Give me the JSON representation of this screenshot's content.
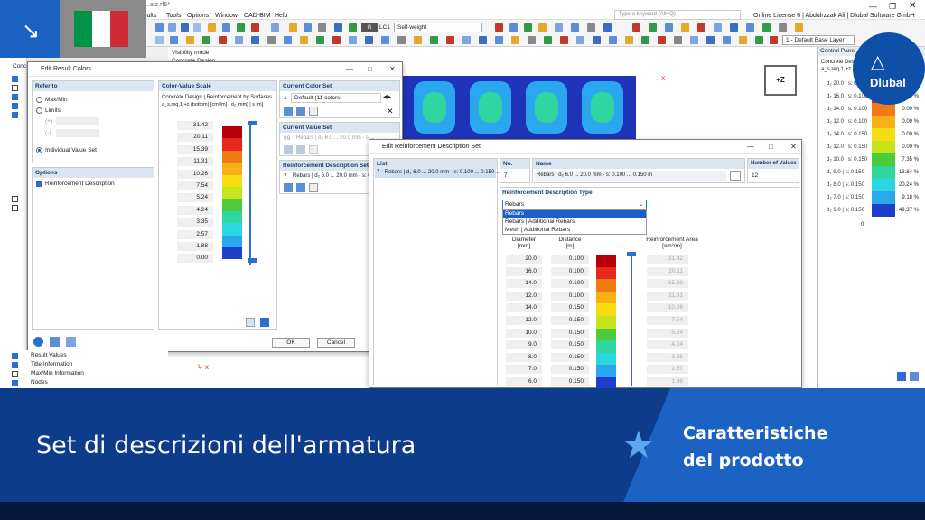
{
  "app": {
    "file_title": "...atz.rf6*",
    "menus": [
      "Results",
      "Tools",
      "Options",
      "Window",
      "CAD-BIM",
      "Help"
    ],
    "search_placeholder": "Type a keyword (Alt+Q)",
    "license_text": "Online License 6 | Abdulrzzak Ali | Dlubal Software GmbH",
    "load_case_badge": "G",
    "load_case": "LC1",
    "load_case_name": "Self-weight",
    "base_layer": "1 - Default Base Layer",
    "visibility_mode": "Visibility mode",
    "concrete_design": "Concrete Design",
    "view_label": "+Z",
    "nav_label": "Conc"
  },
  "navigator_bottom": {
    "items": [
      "Result Values",
      "Title Information",
      "Max/Min Information",
      "Nodes"
    ]
  },
  "control_panel": {
    "title": "Control Panel",
    "subtitle1": "Concrete Design | Reinf...",
    "subtitle2": "a_s,req,1,+z (bottom)",
    "rows": [
      {
        "label": "d₂ 20.0 | s: 0.100",
        "pct": "0.00 %",
        "color": "#b5000c"
      },
      {
        "label": "d₂ 16.0 | s: 0.100",
        "pct": "0.00 %",
        "color": "#e8281c"
      },
      {
        "label": "d₂ 14.0 | s: 0.100",
        "pct": "0.00 %",
        "color": "#f07a14"
      },
      {
        "label": "d₂ 12.0 | s: 0.100",
        "pct": "0.00 %",
        "color": "#f7b016"
      },
      {
        "label": "d₂ 14.0 | s: 0.150",
        "pct": "0.00 %",
        "color": "#f5dd12"
      },
      {
        "label": "d₂ 12.0 | s: 0.150",
        "pct": "0.00 %",
        "color": "#c6e41c"
      },
      {
        "label": "d₂ 10.0 | s: 0.150",
        "pct": "7.35 %",
        "color": "#4ccc3c"
      },
      {
        "label": "d₂ 9.0 | s: 0.150",
        "pct": "13.84 %",
        "color": "#2fd6a0"
      },
      {
        "label": "d₂ 8.0 | s: 0.150",
        "pct": "20.24 %",
        "color": "#2ad6e0"
      },
      {
        "label": "d₂ 7.0 | s: 0.150",
        "pct": "9.18 %",
        "color": "#2aa8ee"
      },
      {
        "label": "d₂ 6.0 | s: 0.150",
        "pct": "49.37 %",
        "color": "#1c3ec8"
      }
    ],
    "last_value": "0"
  },
  "dialog1": {
    "title": "Edit Result Colors",
    "refer_to": "Refer to",
    "opt_maxmin": "Max/Min",
    "opt_limits": "Limits",
    "plus": "(+)",
    "minus": "(-)",
    "opt_individual": "Individual Value Set",
    "options": "Options",
    "reinf_desc": "Reinforcement Description",
    "color_value_scale": "Color-Value Scale",
    "scale_line1": "Concrete Design | Reinforcement by Surfaces",
    "scale_line2": "a_s,req,1,+z (bottom) [cm²/m] | d₂ [mm] | s [m]",
    "scale_values": [
      "31.42",
      "20.11",
      "15.39",
      "11.31",
      "10.26",
      "7.54",
      "5.24",
      "4.24",
      "3.35",
      "2.57",
      "1.88",
      "0.00"
    ],
    "scale_colors": [
      "#b5000c",
      "#e8281c",
      "#f07a14",
      "#f7b016",
      "#f5dd12",
      "#c6e41c",
      "#4ccc3c",
      "#2fd6a0",
      "#2ad6e0",
      "#2aa8ee",
      "#1c3ec8"
    ],
    "current_color_set": "Current Color Set",
    "color_set_no": "1",
    "color_set_name": "Default (11 colors)",
    "current_value_set": "Current Value Set",
    "value_set_no": "99",
    "value_set_name": "Rebars | d₂ 6.0 ... 20.0 mm - s ...",
    "reinf_desc_set": "Reinforcement Description Set",
    "reinf_set_no": "7",
    "reinf_set_name": "Rebars | d₂ 6.0 ... 20.0 mm - s: 0.100 ...",
    "ok": "OK",
    "cancel": "Cancel"
  },
  "dialog2": {
    "title": "Edit Reinforcement Description Set",
    "list_head": "List",
    "list_item": "7 - Rebars | d₂ 6.0 ... 20.0 mm - s: 0.100 ... 0.150 ...",
    "no_head": "No.",
    "no_value": "7",
    "name_head": "Name",
    "name_value": "Rebars | d₂ 6.0 ... 20.0 mm - s: 0.100 ... 0.150 m",
    "num_values_head": "Number of Values",
    "num_values": "12",
    "type_head": "Reinforcement Description Type",
    "type_selected": "Rebars",
    "type_options": [
      "Rebars",
      "Rebars | Additional Rebars",
      "Mesh | Additional Rebars"
    ],
    "col_diameter": "Diameter",
    "col_diameter_unit": "[mm]",
    "col_distance": "Distance",
    "col_distance_unit": "[m]",
    "col_area": "Reinforcement Area",
    "col_area_unit": "[cm²/m]",
    "rows": [
      {
        "d": "20.0",
        "s": "0.100",
        "a": "31.42",
        "color": "#b5000c"
      },
      {
        "d": "16.0",
        "s": "0.100",
        "a": "20.11",
        "color": "#e8281c"
      },
      {
        "d": "14.0",
        "s": "0.100",
        "a": "15.39",
        "color": "#f07a14"
      },
      {
        "d": "12.0",
        "s": "0.100",
        "a": "11.31",
        "color": "#f7b016"
      },
      {
        "d": "14.0",
        "s": "0.150",
        "a": "10.26",
        "color": "#f5dd12"
      },
      {
        "d": "12.0",
        "s": "0.150",
        "a": "7.54",
        "color": "#c6e41c"
      },
      {
        "d": "10.0",
        "s": "0.150",
        "a": "5.24",
        "color": "#4ccc3c"
      },
      {
        "d": "9.0",
        "s": "0.150",
        "a": "4.24",
        "color": "#2fd6a0"
      },
      {
        "d": "8.0",
        "s": "0.150",
        "a": "3.35",
        "color": "#2ad6e0"
      },
      {
        "d": "7.0",
        "s": "0.150",
        "a": "2.57",
        "color": "#2aa8ee"
      },
      {
        "d": "6.0",
        "s": "0.150",
        "a": "1.88",
        "color": "#1c3ec8"
      }
    ]
  },
  "banner": {
    "title": "Set di descrizioni dell'armatura",
    "subtitle_line1": "Caratteristiche",
    "subtitle_line2": "del prodotto",
    "logo_text": "Dlubal"
  },
  "colors": {
    "banner_bg": "#0d3d8a",
    "banner_accent": "#1b62c2",
    "logo_bg": "#0e4fa8"
  }
}
